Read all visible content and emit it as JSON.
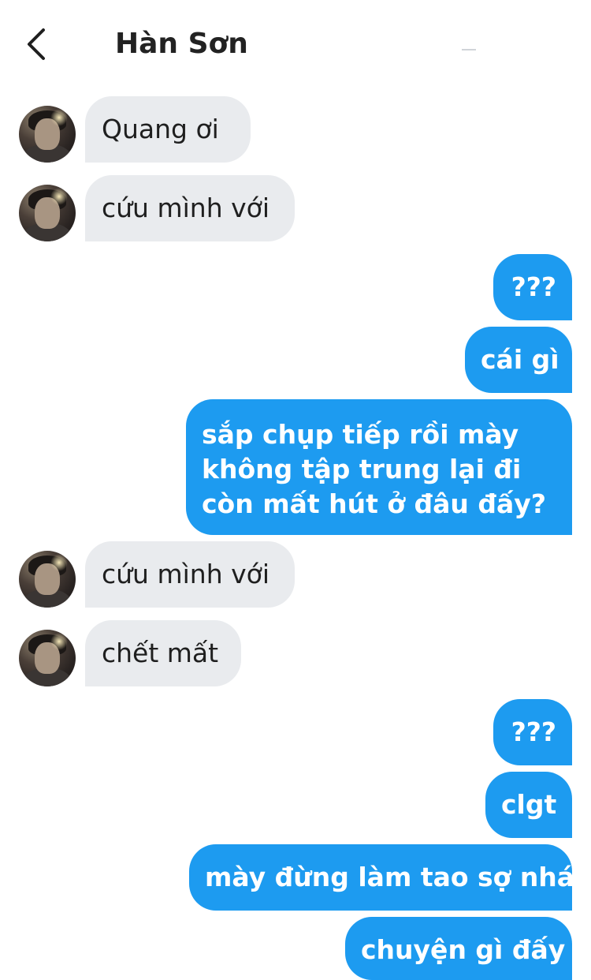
{
  "header": {
    "contact_name": "Hàn Sơn",
    "back_icon": "chevron-left-icon"
  },
  "messages": [
    {
      "sender": "them",
      "text": "Quang ơi"
    },
    {
      "sender": "them",
      "text": "cứu mình với"
    },
    {
      "sender": "me",
      "text": "???"
    },
    {
      "sender": "me",
      "text": "cái gì"
    },
    {
      "sender": "me",
      "lines": [
        "sắp chụp tiếp rồi mày",
        "không tập trung lại đi",
        "còn mất hút ở đâu đấy?"
      ]
    },
    {
      "sender": "them",
      "text": "cứu mình với"
    },
    {
      "sender": "them",
      "text": "chết mất"
    },
    {
      "sender": "me",
      "text": "???"
    },
    {
      "sender": "me",
      "text": "clgt"
    },
    {
      "sender": "me",
      "text": "mày đừng làm tao sợ nhá"
    },
    {
      "sender": "me",
      "text": "chuyện gì đấy"
    }
  ],
  "colors": {
    "outgoing_bubble": "#1d9bf0",
    "incoming_bubble": "#e9ebee",
    "title_text": "#222222"
  }
}
